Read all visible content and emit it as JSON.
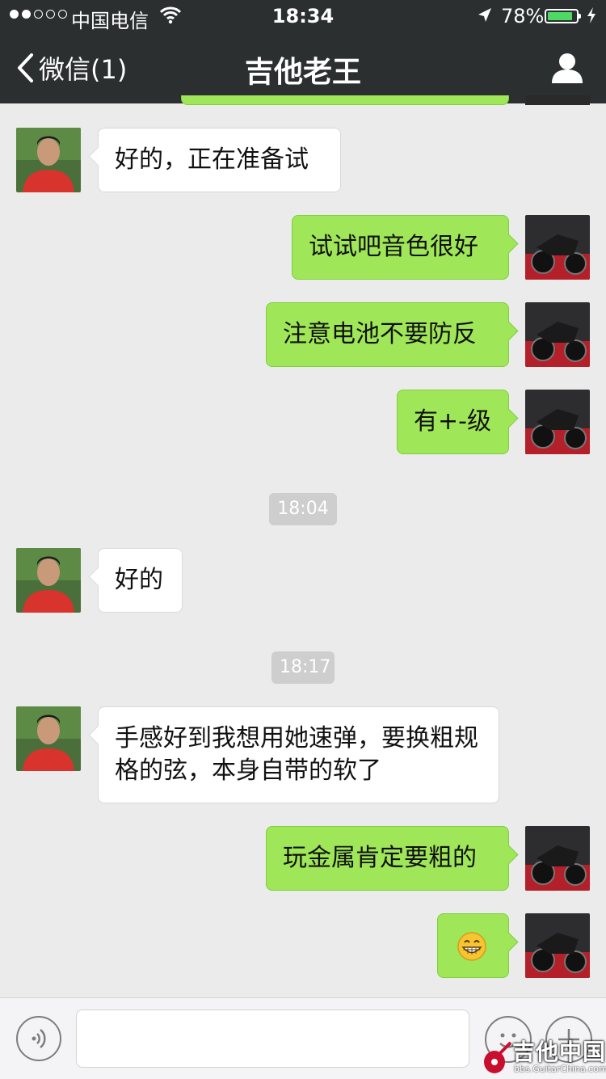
{
  "status_bar": {
    "carrier": "中国电信",
    "time": "18:34",
    "battery": "78%",
    "battery_level": 0.78
  },
  "nav": {
    "back_label": "微信(1)",
    "title": "吉他老王"
  },
  "messages": [
    {
      "side": "left",
      "text": "好的，正在准备试"
    },
    {
      "side": "right",
      "text": "试试吧音色很好"
    },
    {
      "side": "right",
      "text": "注意电池不要防反"
    },
    {
      "side": "right",
      "text": "有+-级"
    },
    {
      "timestamp": "18:04"
    },
    {
      "side": "left",
      "text": "好的"
    },
    {
      "timestamp": "18:17"
    },
    {
      "side": "left",
      "text": "手感好到我想用她速弹，要换粗规格的弦，本身自带的软了"
    },
    {
      "side": "right",
      "text": "玩金属肯定要粗的"
    },
    {
      "side": "right",
      "emoji": "grinning-face"
    }
  ],
  "input_bar": {
    "text_value": ""
  },
  "watermark": {
    "title": "吉他中国",
    "url": "bbs.GuitarChina.com"
  },
  "colors": {
    "nav_bg": "#2b2f30",
    "chat_bg": "#ebebeb",
    "bubble_mine": "#9fe658",
    "bubble_other": "#ffffff",
    "timestamp_bg": "#cecece",
    "battery_fill": "#4cd964"
  }
}
